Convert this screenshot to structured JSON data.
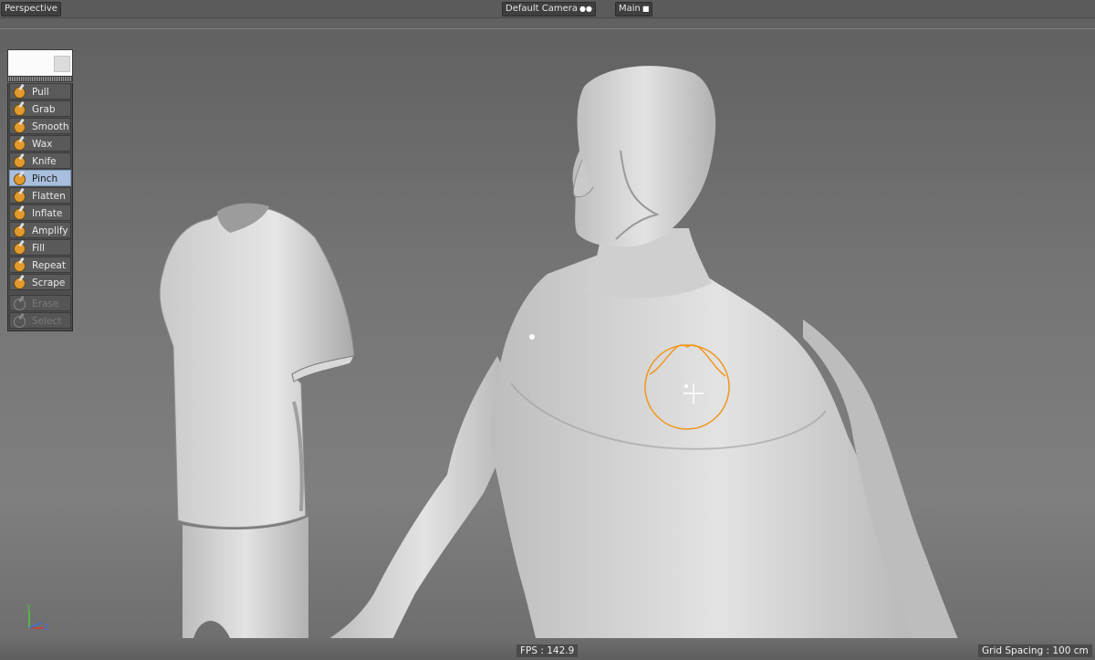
{
  "viewport": {
    "view_label": "Perspective",
    "camera_label": "Default Camera",
    "main_label": "Main"
  },
  "sculpt_palette": {
    "tools": [
      {
        "label": "Pull",
        "state": "normal"
      },
      {
        "label": "Grab",
        "state": "normal"
      },
      {
        "label": "Smooth",
        "state": "normal"
      },
      {
        "label": "Wax",
        "state": "normal"
      },
      {
        "label": "Knife",
        "state": "normal"
      },
      {
        "label": "Pinch",
        "state": "selected"
      },
      {
        "label": "Flatten",
        "state": "normal"
      },
      {
        "label": "Inflate",
        "state": "normal"
      },
      {
        "label": "Amplify",
        "state": "normal"
      },
      {
        "label": "Fill",
        "state": "normal"
      },
      {
        "label": "Repeat",
        "state": "normal"
      },
      {
        "label": "Scrape",
        "state": "normal"
      }
    ],
    "disabled_tools": [
      {
        "label": "Erase",
        "state": "disabled"
      },
      {
        "label": "Select",
        "state": "disabled"
      }
    ]
  },
  "status": {
    "fps": "FPS : 142.9",
    "grid_spacing": "Grid Spacing : 100 cm"
  },
  "axis": {
    "y": "Y",
    "z": "Z"
  },
  "colors": {
    "brush_ring": "#f0961e",
    "selected_tool": "#a8bedc",
    "axis_y": "#4ecb3a",
    "axis_z": "#3a6bd6",
    "axis_x": "#d83a2a"
  }
}
